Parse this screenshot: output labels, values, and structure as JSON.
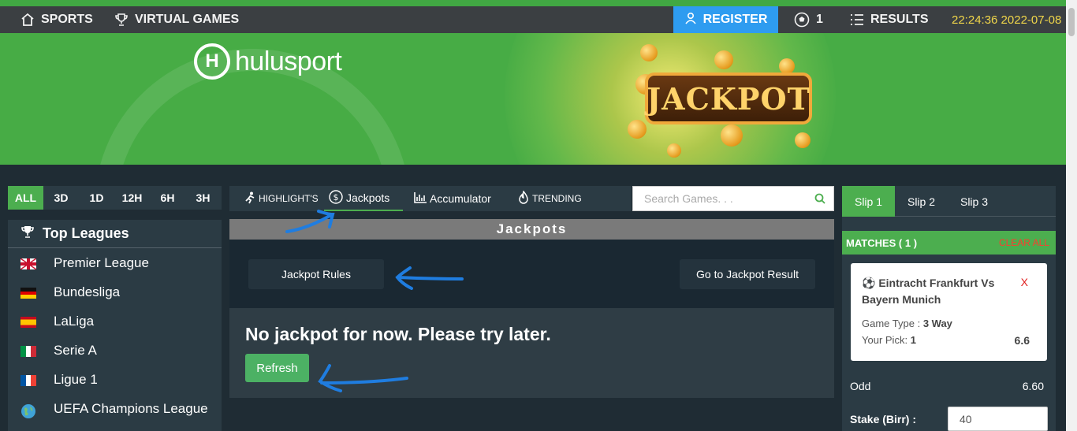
{
  "nav": {
    "sports": "SPORTS",
    "virtual_games": "VIRTUAL GAMES",
    "register": "REGISTER",
    "slip_count": "1",
    "results": "RESULTS",
    "clock": "22:24:36 2022-07-08"
  },
  "banner": {
    "logo_letter": "H",
    "logo_text": "hulusport",
    "jackpot_word": "JACKPOT"
  },
  "time_filters": [
    "ALL",
    "3D",
    "1D",
    "12H",
    "6H",
    "3H"
  ],
  "leagues": {
    "title": "Top Leagues",
    "items": [
      "Premier League",
      "Bundesliga",
      "LaLiga",
      "Serie A",
      "Ligue 1",
      "UEFA Champions League"
    ]
  },
  "tabs": {
    "highlights": "HIGHLIGHT'S",
    "jackpots": "Jackpots",
    "accumulator": "Accumulator",
    "trending": "TRENDING"
  },
  "search": {
    "placeholder": "Search Games. . ."
  },
  "jackpots": {
    "title": "Jackpots",
    "rules_button": "Jackpot Rules",
    "result_button": "Go to Jackpot Result",
    "empty_message": "No jackpot for now. Please try later.",
    "refresh_button": "Refresh"
  },
  "slip": {
    "tabs": [
      "Slip 1",
      "Slip 2",
      "Slip 3"
    ],
    "matches_label": "MATCHES ( 1 )",
    "clear_all": "CLEAR ALL",
    "match_title": "Eintracht Frankfurt Vs Bayern Munich",
    "remove": "X",
    "game_type_label": "Game Type :",
    "game_type_value": "3 Way",
    "pick_label": "Your Pick:",
    "pick_value": "1",
    "pick_odd": "6.6",
    "odd_label": "Odd",
    "odd_value": "6.60",
    "stake_label": "Stake (Birr) :",
    "stake_value": "40"
  },
  "colors": {
    "brand_green": "#4cae4f",
    "register_blue": "#2e9cf0",
    "clock_yellow": "#f0d64a",
    "annotation_arrow": "#1f7de0"
  }
}
